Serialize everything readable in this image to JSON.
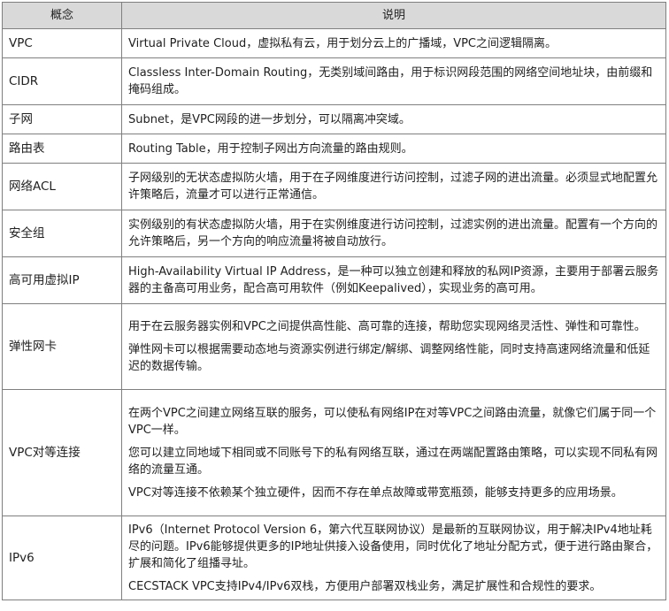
{
  "table": {
    "headers": [
      "概念",
      "说明"
    ],
    "rows": [
      {
        "term": "VPC",
        "paragraphs": [
          "Virtual Private Cloud，虚拟私有云，用于划分云上的广播域，VPC之间逻辑隔离。"
        ]
      },
      {
        "term": "CIDR",
        "paragraphs": [
          "Classless Inter-Domain Routing，无类别域间路由，用于标识网段范围的网络空间地址块，由前缀和掩码组成。"
        ]
      },
      {
        "term": "子网",
        "paragraphs": [
          "Subnet，是VPC网段的进一步划分，可以隔离冲突域。"
        ]
      },
      {
        "term": "路由表",
        "paragraphs": [
          "Routing Table，用于控制子网出方向流量的路由规则。"
        ]
      },
      {
        "term": "网络ACL",
        "paragraphs": [
          "子网级别的无状态虚拟防火墙，用于在子网维度进行访问控制，过滤子网的进出流量。必须显式地配置允许策略后，流量才可以进行正常通信。"
        ]
      },
      {
        "term": "安全组",
        "paragraphs": [
          "实例级别的有状态虚拟防火墙，用于在实例维度进行访问控制，过滤实例的进出流量。配置有一个方向的允许策略后，另一个方向的响应流量将被自动放行。"
        ]
      },
      {
        "term": "高可用虚拟IP",
        "paragraphs": [
          "High-Availability Virtual IP Address，是一种可以独立创建和释放的私网IP资源，主要用于部署云服务器的主备高可用业务，配合高可用软件（例如Keepalived），实现业务的高可用。"
        ]
      },
      {
        "term": "弹性网卡",
        "paragraphs": [
          "用于在云服务器实例和VPC之间提供高性能、高可靠的连接，帮助您实现网络灵活性、弹性和可靠性。",
          "弹性网卡可以根据需要动态地与资源实例进行绑定/解绑、调整网络性能，同时支持高速网络流量和低延迟的数据传输。"
        ]
      },
      {
        "term": "VPC对等连接",
        "paragraphs": [
          "在两个VPC之间建立网络互联的服务，可以使私有网络IP在对等VPC之间路由流量，就像它们属于同一个VPC一样。",
          "您可以建立同地域下相同或不同账号下的私有网络互联，通过在两端配置路由策略，可以实现不同私有网络的流量互通。",
          "VPC对等连接不依赖某个独立硬件，因而不存在单点故障或带宽瓶颈，能够支持更多的应用场景。"
        ]
      },
      {
        "term": "IPv6",
        "paragraphs": [
          "IPv6（Internet Protocol Version 6，第六代互联网协议）是最新的互联网协议，用于解决IPv4地址耗尽的问题。IPv6能够提供更多的IP地址供接入设备使用，同时优化了地址分配方式，便于进行路由聚合，扩展和简化了组播寻址。",
          "CECSTACK VPC支持IPv4/IPv6双栈，方便用户部署双栈业务，满足扩展性和合规性的要求。"
        ]
      }
    ]
  }
}
